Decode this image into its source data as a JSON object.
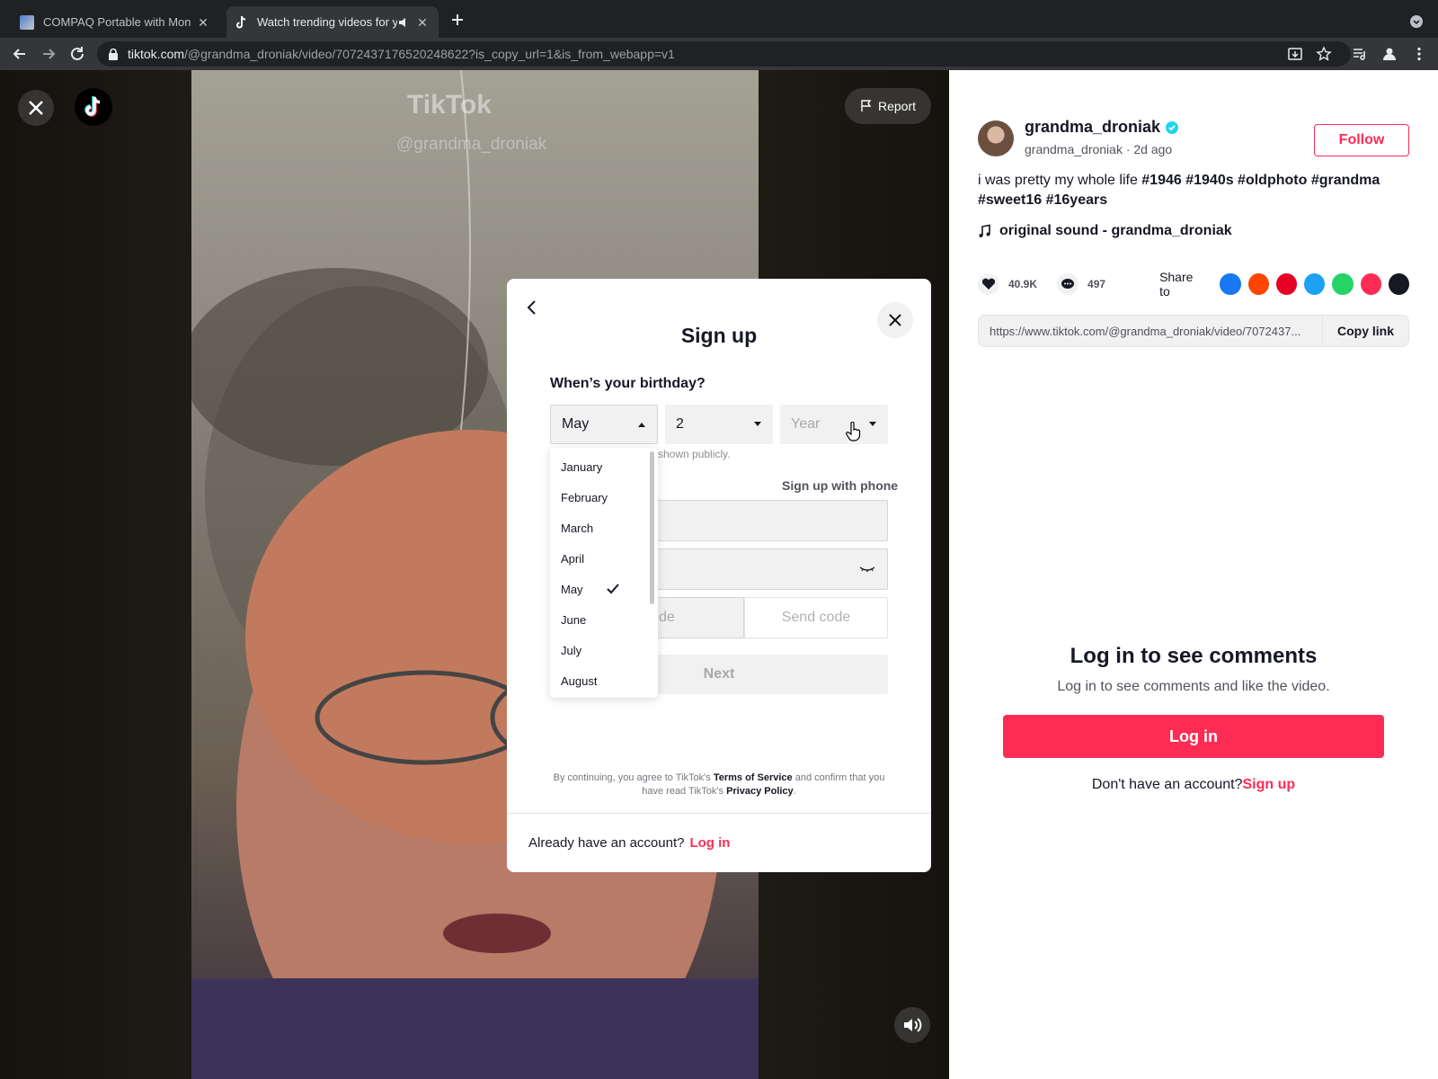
{
  "browser": {
    "tabs": [
      {
        "title": "COMPAQ Portable with Monoc"
      },
      {
        "title": "Watch trending videos for y"
      }
    ],
    "url_host": "tiktok.com",
    "url_path": "/@grandma_droniak/video/7072437176520248622?is_copy_url=1&is_from_webapp=v1"
  },
  "video": {
    "report_label": "Report",
    "watermark_logo": "TikTok",
    "watermark_user": "@grandma_droniak"
  },
  "post": {
    "username": "grandma_droniak",
    "subline": "grandma_droniak · 2d ago",
    "follow_label": "Follow",
    "description_text": "i was pretty my whole life ",
    "hashtags_line1": "#1946 #1940s #oldphoto #grandma",
    "hashtags_line2": "#sweet16 #16years",
    "sound": "original sound - grandma_droniak",
    "likes": "40.9K",
    "comments": "497",
    "share_label": "Share to",
    "share_icons": [
      "facebook-icon",
      "reddit-icon",
      "pinterest-icon",
      "twitter-icon",
      "whatsapp-icon",
      "telegram-icon",
      "embed-icon"
    ],
    "share_colors": [
      "#1877f2",
      "#ff4500",
      "#e60023",
      "#1da1f2",
      "#25d366",
      "#fe2c55",
      "#161823"
    ],
    "link": "https://www.tiktok.com/@grandma_droniak/video/7072437...",
    "copy_link_label": "Copy link"
  },
  "comments_section": {
    "title": "Log in to see comments",
    "subtitle": "Log in to see comments and like the video.",
    "login_label": "Log in",
    "no_account_text": "Don't have an account?",
    "signup_link": "Sign up"
  },
  "modal": {
    "title": "Sign up",
    "birthday_label": "When’s your birthday?",
    "month_value": "May",
    "day_value": "2",
    "year_placeholder": "Year",
    "public_note": "shown publicly.",
    "phone_link": "Sign up with phone",
    "code_placeholder_fragment": "de",
    "send_code_label": "Send code",
    "next_label": "Next",
    "terms_prefix": "By continuing, you agree to TikTok's ",
    "terms_link": "Terms of Service",
    "terms_middle": " and confirm that you have read TikTok's ",
    "privacy_link": "Privacy Policy",
    "terms_suffix": ".",
    "footer_text": "Already have an account?",
    "footer_link": "Log in",
    "month_options": [
      "January",
      "February",
      "March",
      "April",
      "May",
      "June",
      "July",
      "August"
    ],
    "selected_month": "May"
  },
  "colors": {
    "accent": "#fe2c55",
    "verified": "#20d5ec"
  }
}
